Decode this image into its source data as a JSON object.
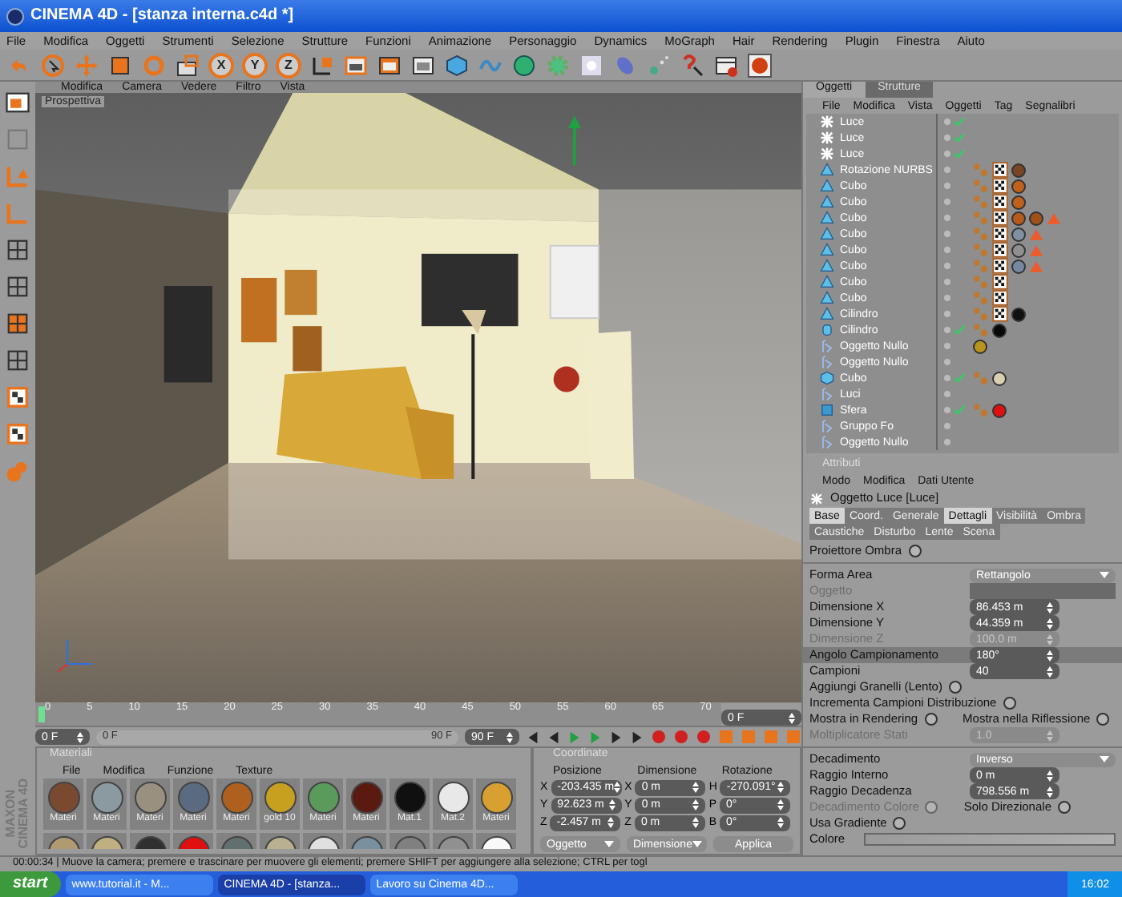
{
  "window": {
    "title": "CINEMA 4D - [stanza interna.c4d *]"
  },
  "menu": [
    "File",
    "Modifica",
    "Oggetti",
    "Strumenti",
    "Selezione",
    "Strutture",
    "Funzioni",
    "Animazione",
    "Personaggio",
    "Dynamics",
    "MoGraph",
    "Hair",
    "Rendering",
    "Plugin",
    "Finestra",
    "Aiuto"
  ],
  "toolbar": {
    "axes": [
      "X",
      "Y",
      "Z"
    ]
  },
  "viewport": {
    "menu": [
      "Modifica",
      "Camera",
      "Vedere",
      "Filtro",
      "Vista"
    ],
    "label": "Prospettiva"
  },
  "object_manager": {
    "tabs": [
      {
        "label": "Oggetti",
        "selected": true
      },
      {
        "label": "Strutture",
        "selected": false
      }
    ],
    "menu": [
      "File",
      "Modifica",
      "Vista",
      "Oggetti",
      "Tag",
      "Segnalibri"
    ],
    "rows": [
      {
        "name": "Luce",
        "kind": "light",
        "checked": true,
        "tags": []
      },
      {
        "name": "Luce",
        "kind": "light",
        "checked": true,
        "tags": []
      },
      {
        "name": "Luce",
        "kind": "light",
        "checked": true,
        "tags": []
      },
      {
        "name": "Rotazione NURBS",
        "kind": "polygon",
        "checked": false,
        "tags": [
          {
            "kind": "phong"
          },
          {
            "kind": "texture"
          },
          {
            "kind": "material",
            "color": "#7a4524"
          }
        ]
      },
      {
        "name": "Cubo",
        "kind": "polygon",
        "checked": false,
        "tags": [
          {
            "kind": "phong"
          },
          {
            "kind": "texture"
          },
          {
            "kind": "material",
            "color": "#c0601a"
          }
        ]
      },
      {
        "name": "Cubo",
        "kind": "polygon",
        "checked": false,
        "tags": [
          {
            "kind": "phong"
          },
          {
            "kind": "texture"
          },
          {
            "kind": "material",
            "color": "#c0601a"
          }
        ]
      },
      {
        "name": "Cubo",
        "kind": "polygon",
        "checked": false,
        "tags": [
          {
            "kind": "phong"
          },
          {
            "kind": "texture"
          },
          {
            "kind": "material",
            "color": "#b85a1a"
          },
          {
            "kind": "material",
            "color": "#a0501a"
          },
          {
            "kind": "warning"
          }
        ]
      },
      {
        "name": "Cubo",
        "kind": "polygon",
        "checked": false,
        "tags": [
          {
            "kind": "phong"
          },
          {
            "kind": "texture"
          },
          {
            "kind": "material",
            "color": "#8090a0"
          },
          {
            "kind": "warning"
          }
        ]
      },
      {
        "name": "Cubo",
        "kind": "polygon",
        "checked": false,
        "tags": [
          {
            "kind": "phong"
          },
          {
            "kind": "texture"
          },
          {
            "kind": "material",
            "color": "#909090"
          },
          {
            "kind": "warning"
          }
        ]
      },
      {
        "name": "Cubo",
        "kind": "polygon",
        "checked": false,
        "tags": [
          {
            "kind": "phong"
          },
          {
            "kind": "texture"
          },
          {
            "kind": "material",
            "color": "#7888a0"
          },
          {
            "kind": "warning"
          }
        ]
      },
      {
        "name": "Cubo",
        "kind": "polygon",
        "checked": false,
        "tags": [
          {
            "kind": "phong"
          },
          {
            "kind": "texture"
          }
        ]
      },
      {
        "name": "Cubo",
        "kind": "polygon",
        "checked": false,
        "tags": [
          {
            "kind": "phong"
          },
          {
            "kind": "texture"
          }
        ]
      },
      {
        "name": "Cilindro",
        "kind": "polygon",
        "checked": false,
        "tags": [
          {
            "kind": "phong"
          },
          {
            "kind": "texture"
          },
          {
            "kind": "material",
            "color": "#101010"
          }
        ]
      },
      {
        "name": "Cilindro",
        "kind": "cylinder",
        "checked": true,
        "tags": [
          {
            "kind": "phong"
          },
          {
            "kind": "material",
            "color": "#080808"
          }
        ]
      },
      {
        "name": "Oggetto Nullo",
        "kind": "null",
        "checked": false,
        "tags": [
          {
            "kind": "material",
            "color": "#b8941a"
          }
        ]
      },
      {
        "name": "Oggetto Nullo",
        "kind": "null",
        "checked": false,
        "tags": []
      },
      {
        "name": "Cubo",
        "kind": "cube",
        "checked": true,
        "tags": [
          {
            "kind": "phong"
          },
          {
            "kind": "material",
            "color": "#d8d0b0"
          }
        ]
      },
      {
        "name": "Luci",
        "kind": "null",
        "checked": false,
        "tags": []
      },
      {
        "name": "Sfera",
        "kind": "sphere",
        "checked": true,
        "tags": [
          {
            "kind": "phong"
          },
          {
            "kind": "material",
            "color": "#e01010"
          }
        ]
      },
      {
        "name": "Gruppo Fo",
        "kind": "null",
        "checked": false,
        "tags": []
      },
      {
        "name": "Oggetto Nullo",
        "kind": "null",
        "checked": false,
        "tags": []
      }
    ]
  },
  "attributes": {
    "title": "Attributi",
    "menu": [
      "Modo",
      "Modifica",
      "Dati Utente"
    ],
    "object": "Oggetto Luce [Luce]",
    "tabs": [
      [
        {
          "label": "Base",
          "selected": true
        },
        {
          "label": "Coord.",
          "selected": false
        },
        {
          "label": "Generale",
          "selected": false
        },
        {
          "label": "Dettagli",
          "selected": true
        },
        {
          "label": "Visibilità",
          "selected": false
        },
        {
          "label": "Ombra",
          "selected": false
        }
      ],
      [
        {
          "label": "Caustiche",
          "selected": false
        },
        {
          "label": "Disturbo",
          "selected": false
        },
        {
          "label": "Lente",
          "selected": false
        },
        {
          "label": "Scena",
          "selected": false
        }
      ]
    ],
    "groups": [
      [
        {
          "kind": "check",
          "label": "Proiettore Ombra",
          "checked": false,
          "disabled": false,
          "selected": false
        }
      ],
      [
        {
          "kind": "dropdown",
          "label": "Forma Area",
          "value": "Rettangolo",
          "disabled": false,
          "selected": false
        },
        {
          "kind": "link",
          "label": "Oggetto",
          "disabled": true,
          "selected": false
        },
        {
          "kind": "number",
          "label": "Dimensione X",
          "value": "86.453 m",
          "disabled": false,
          "selected": false
        },
        {
          "kind": "number",
          "label": "Dimensione Y",
          "value": "44.359 m",
          "disabled": false,
          "selected": false
        },
        {
          "kind": "number",
          "label": "Dimensione Z",
          "value": "100.0 m",
          "disabled": true,
          "selected": false
        },
        {
          "kind": "number",
          "label": "Angolo Campionamento",
          "value": "180°",
          "disabled": false,
          "selected": true
        },
        {
          "kind": "number",
          "label": "Campioni",
          "value": "40",
          "disabled": false,
          "selected": false
        },
        {
          "kind": "check",
          "label": "Aggiungi Granelli (Lento)",
          "checked": false,
          "disabled": false,
          "selected": false
        },
        {
          "kind": "check",
          "label": "Incrementa Campioni Distribuzione",
          "checked": false,
          "disabled": false,
          "selected": false
        },
        {
          "kind": "check2",
          "label": "Mostra in Rendering",
          "checked": false,
          "label2": "Mostra nella Riflessione",
          "checked2": false,
          "disabled": false,
          "selected": false
        },
        {
          "kind": "number",
          "label": "Moltiplicatore Stati",
          "value": "1.0",
          "disabled": true,
          "selected": false
        }
      ],
      [
        {
          "kind": "dropdown",
          "label": "Decadimento",
          "value": "Inverso",
          "disabled": false,
          "selected": false
        },
        {
          "kind": "number",
          "label": "Raggio Interno",
          "value": "0 m",
          "disabled": false,
          "selected": false
        },
        {
          "kind": "number",
          "label": "Raggio Decadenza",
          "value": "798.556 m",
          "disabled": false,
          "selected": false
        },
        {
          "kind": "check2",
          "label": "Decadimento Colore",
          "checked": false,
          "label2": "Solo Direzionale",
          "checked2": false,
          "disabled": true,
          "selected": false
        },
        {
          "kind": "check",
          "label": "Usa Gradiente",
          "checked": false,
          "disabled": false,
          "selected": false
        },
        {
          "kind": "gradient",
          "label": "Colore",
          "disabled": false,
          "selected": false
        }
      ]
    ]
  },
  "timeline": {
    "ticks": [
      "0",
      "5",
      "10",
      "15",
      "20",
      "25",
      "30",
      "35",
      "40",
      "45",
      "50",
      "55",
      "60",
      "65",
      "70"
    ],
    "frame": "0 F",
    "level": 1,
    "start": "0 F",
    "bar_start": "0 F",
    "bar_end": "90 F",
    "end": "90 F"
  },
  "materials": {
    "title": "Materiali",
    "menu": [
      "File",
      "Modifica",
      "Funzione",
      "Texture"
    ],
    "items": [
      {
        "name": "Materi",
        "color": "#7a4a30"
      },
      {
        "name": "Materi",
        "color": "#8a9aa0"
      },
      {
        "name": "Materi",
        "color": "#9a9080"
      },
      {
        "name": "Materi",
        "color": "#5a6a80"
      },
      {
        "name": "Materi",
        "color": "#b0601e"
      },
      {
        "name": "gold 10",
        "color": "#c8a020"
      },
      {
        "name": "Materi",
        "color": "#5a9a5a"
      },
      {
        "name": "Materi",
        "color": "#5a1a10"
      },
      {
        "name": "Mat.1",
        "color": "#101010"
      },
      {
        "name": "Mat.2",
        "color": "#e8e8e8"
      },
      {
        "name": "Materi",
        "color": "#d8a030"
      }
    ],
    "row2": [
      {
        "color": "#b09a70"
      },
      {
        "color": "#c0b080"
      },
      {
        "color": "#303030"
      },
      {
        "color": "#e01010"
      },
      {
        "color": "#607070"
      },
      {
        "color": "#b8b090"
      },
      {
        "color": "#e0e0e0"
      },
      {
        "color": "#7890a0"
      },
      {
        "color": "#808080"
      },
      {
        "color": "#909090"
      },
      {
        "color": "#f8f8f8"
      }
    ]
  },
  "coordinates": {
    "title": "Coordinate",
    "headers": [
      "Posizione",
      "Dimensione",
      "Rotazione"
    ],
    "rows": [
      {
        "axis": "X",
        "position": "-203.435 m",
        "size_axis": "X",
        "size": "0 m",
        "rot_axis": "H",
        "rotation": "-270.091°"
      },
      {
        "axis": "Y",
        "position": "92.623 m",
        "size_axis": "Y",
        "size": "0 m",
        "rot_axis": "P",
        "rotation": "0°"
      },
      {
        "axis": "Z",
        "position": "-2.457 m",
        "size_axis": "Z",
        "size": "0 m",
        "rot_axis": "B",
        "rotation": "0°"
      }
    ],
    "mode": "Oggetto",
    "size_mode": "Dimensione",
    "apply": "Applica"
  },
  "logo_text": [
    "MAXON",
    "CINEMA 4D"
  ],
  "status": "00:00:34 | Muove la camera; premere e trascinare per muovere gli elementi; premere SHIFT per aggiungere alla selezione; CTRL per togl",
  "taskbar": {
    "start": "start",
    "items": [
      {
        "label": "www.tutorial.it - M...",
        "selected": false
      },
      {
        "label": "CINEMA 4D - [stanza...",
        "selected": true
      },
      {
        "label": "Lavoro su Cinema 4D...",
        "selected": false
      }
    ],
    "clock": "16:02"
  }
}
